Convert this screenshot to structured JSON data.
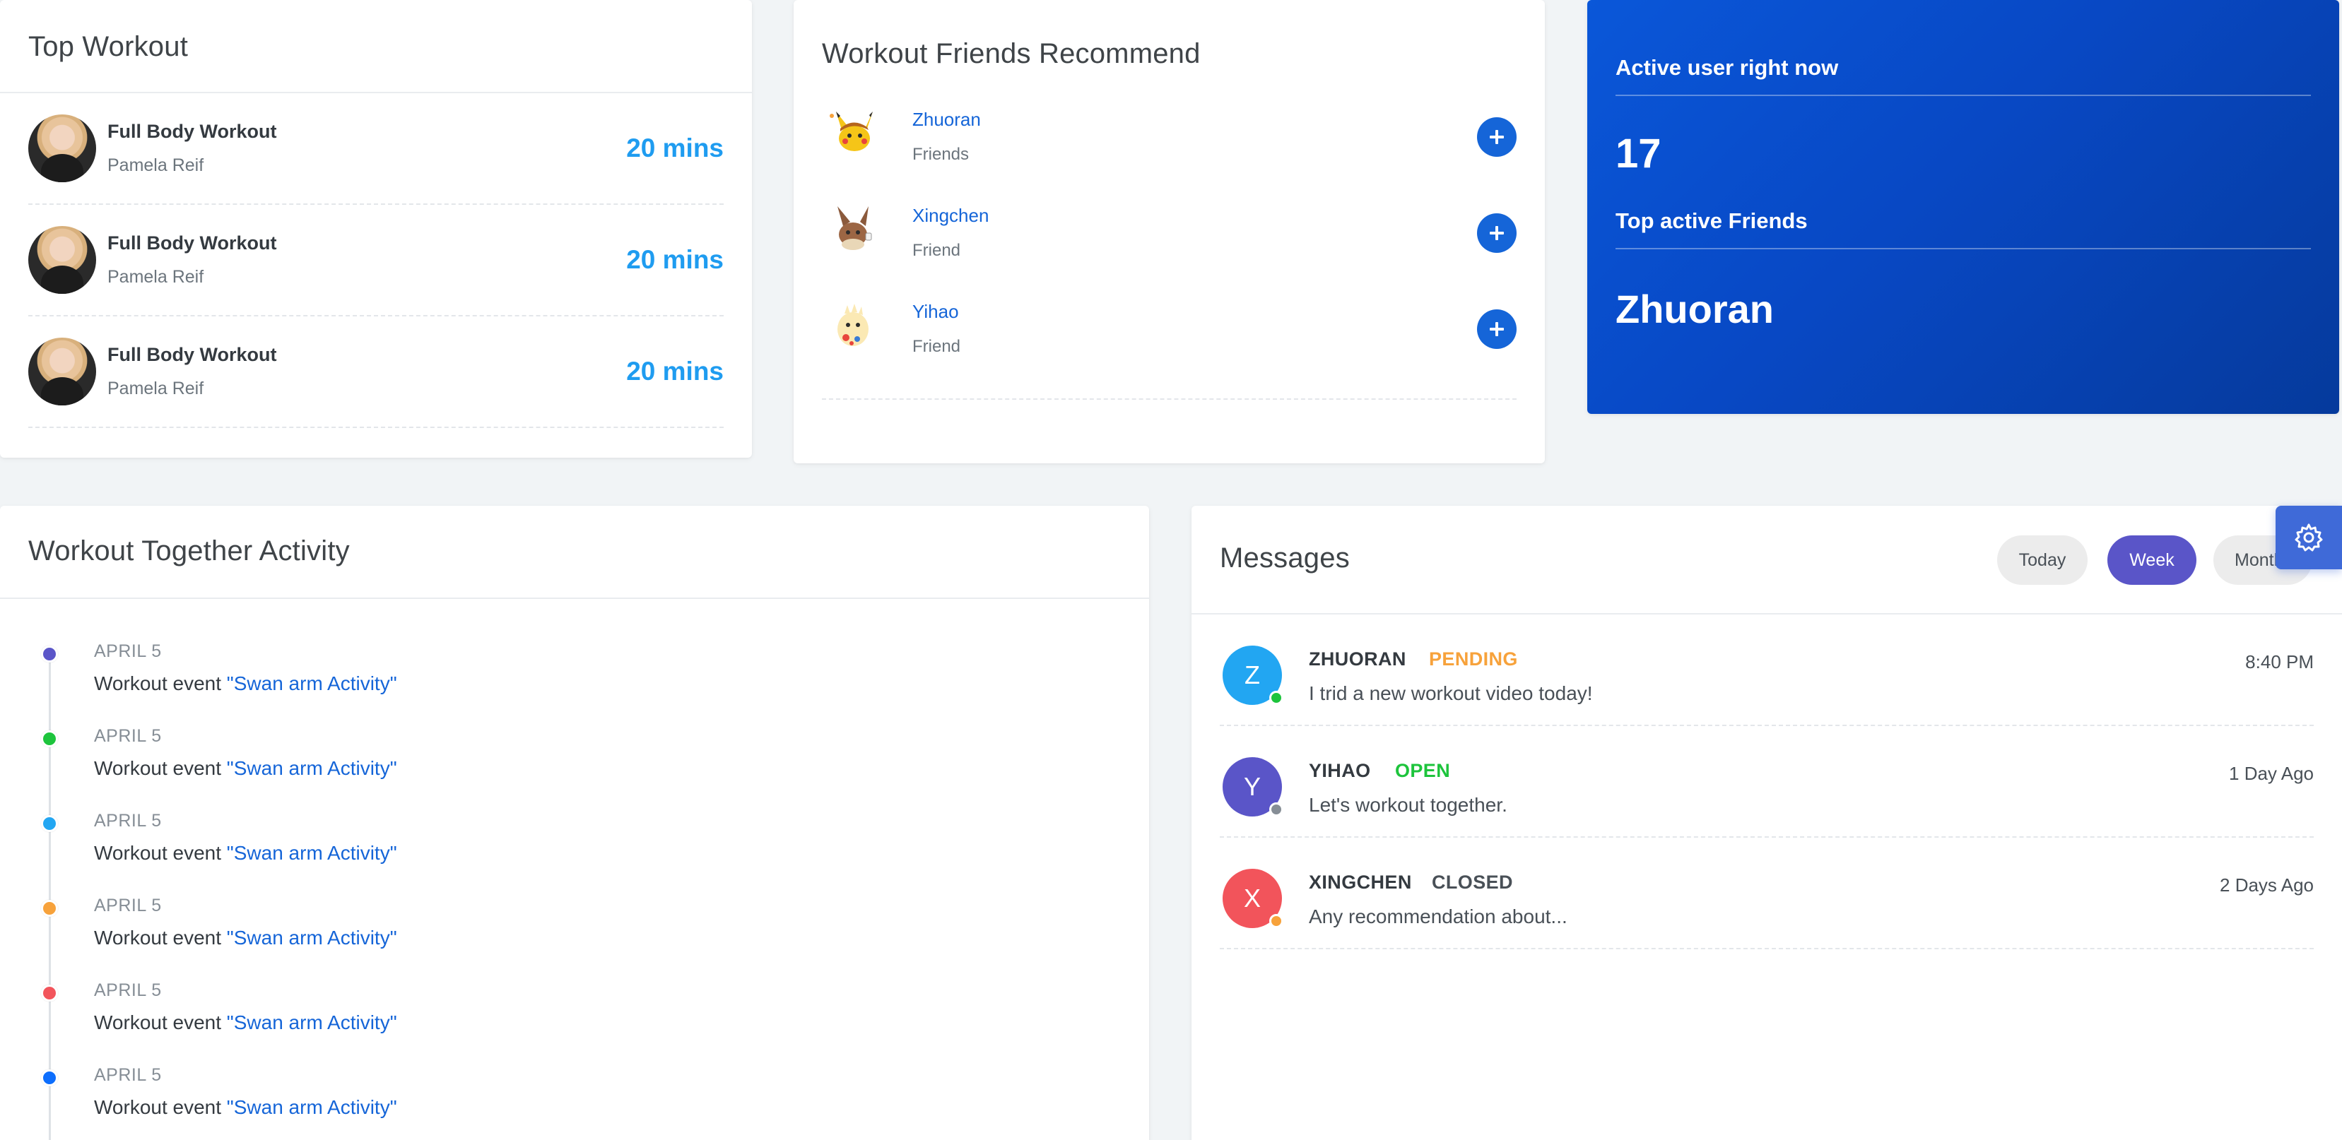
{
  "top_workout": {
    "title": "Top Workout",
    "items": [
      {
        "name": "Full Body Workout",
        "author": "Pamela Reif",
        "duration": "20 mins"
      },
      {
        "name": "Full Body Workout",
        "author": "Pamela Reif",
        "duration": "20 mins"
      },
      {
        "name": "Full Body Workout",
        "author": "Pamela Reif",
        "duration": "20 mins"
      }
    ]
  },
  "friends_recommend": {
    "title": "Workout Friends Recommend",
    "items": [
      {
        "name": "Zhuoran",
        "status": "Friends",
        "avatar_icon": "pikachu-avatar-icon"
      },
      {
        "name": "Xingchen",
        "status": "Friend",
        "avatar_icon": "eevee-avatar-icon"
      },
      {
        "name": "Yihao",
        "status": "Friend",
        "avatar_icon": "togepi-avatar-icon"
      }
    ],
    "add_icon": "plus-icon"
  },
  "active_panel": {
    "label_active": "Active user right now",
    "active_count": "17",
    "label_top_friends": "Top active Friends",
    "top_friend": "Zhuoran"
  },
  "timeline": {
    "title": "Workout Together Activity",
    "items": [
      {
        "date": "APRIL 5",
        "text": "Workout event ",
        "link": "\"Swan arm Activity\"",
        "color": "#5a55c8"
      },
      {
        "date": "APRIL 5",
        "text": "Workout event ",
        "link": "\"Swan arm Activity\"",
        "color": "#1dc43c"
      },
      {
        "date": "APRIL 5",
        "text": "Workout event ",
        "link": "\"Swan arm Activity\"",
        "color": "#22a6f2"
      },
      {
        "date": "APRIL 5",
        "text": "Workout event ",
        "link": "\"Swan arm Activity\"",
        "color": "#f7a23b"
      },
      {
        "date": "APRIL 5",
        "text": "Workout event ",
        "link": "\"Swan arm Activity\"",
        "color": "#f2545b"
      },
      {
        "date": "APRIL 5",
        "text": "Workout event ",
        "link": "\"Swan arm Activity\"",
        "color": "#0d6efd"
      }
    ]
  },
  "messages": {
    "title": "Messages",
    "filters": {
      "today": "Today",
      "week": "Week",
      "month": "Month"
    },
    "active_filter": "Week",
    "items": [
      {
        "initial": "Z",
        "name": "ZHUORAN",
        "status": "PENDING",
        "status_color": "#f7a23b",
        "body": "I trid a new workout video today!",
        "time": "8:40 PM",
        "avatar_color": "#22a6f2",
        "presence_color": "#1dc43c"
      },
      {
        "initial": "Y",
        "name": "YIHAO",
        "status": "OPEN",
        "status_color": "#1dc43c",
        "body": "Let's workout together.",
        "time": "1 Day Ago",
        "avatar_color": "#5a55c8",
        "presence_color": "#868e96"
      },
      {
        "initial": "X",
        "name": "XINGCHEN",
        "status": "CLOSED",
        "status_color": "#495057",
        "body": "Any recommendation about...",
        "time": "2 Days Ago",
        "avatar_color": "#f2545b",
        "presence_color": "#f7a23b"
      }
    ]
  },
  "settings_icon": "gear-icon",
  "colors": {
    "accent_blue": "#1565d8",
    "active_panel": "#0848c4",
    "duration_blue": "#1f9cf0",
    "week_purple": "#5a55c8"
  }
}
